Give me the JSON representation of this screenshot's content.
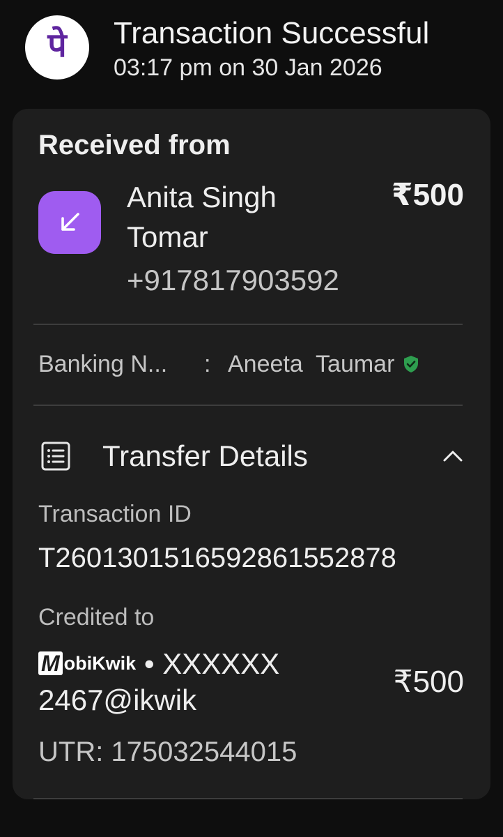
{
  "header": {
    "logo_glyph": "पे",
    "title": "Transaction Successful",
    "timestamp": "03:17 pm on 30 Jan 2026"
  },
  "received": {
    "label": "Received from",
    "sender_name": "Anita Singh Tomar",
    "sender_phone": "+917817903592",
    "amount": "₹500",
    "icon": "arrow-down-left-icon"
  },
  "banking": {
    "label": "Banking N...",
    "separator": ":",
    "name": "Aneeta  Taumar",
    "verified_icon": "verified-shield-icon"
  },
  "transfer": {
    "title": "Transfer Details",
    "icon": "list-icon",
    "toggle_icon": "chevron-up-icon",
    "transaction_id_label": "Transaction ID",
    "transaction_id": "T2601301516592861552878",
    "credited_label": "Credited to",
    "credited_logo_m": "M",
    "credited_logo_rest": "obiKwik",
    "credited_bullet": " • ",
    "credited_account": "XXXXXX 2467@ikwik",
    "credited_amount": "₹500",
    "utr": "UTR: 175032544015"
  },
  "colors": {
    "background": "#0e0e0e",
    "card": "#1e1e1e",
    "brand_purple": "#5f259f",
    "accent_purple": "#9f5cf0",
    "verified_green": "#2e9e4f"
  }
}
